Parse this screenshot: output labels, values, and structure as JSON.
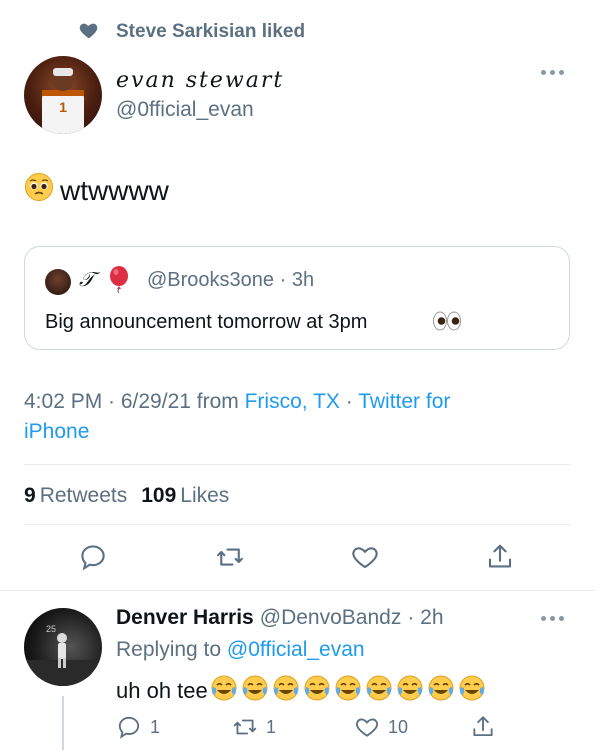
{
  "liked_by": {
    "text": "Steve Sarkisian liked"
  },
  "tweet": {
    "author_name": "evan stewart",
    "author_handle": "@0fficial_evan",
    "text": "wtwwww",
    "emoji": "pleading-face"
  },
  "quoted": {
    "name": "𝒯",
    "handle_time": "@Brooks3one · 3h",
    "text": "Big announcement tomorrow at 3pm"
  },
  "meta": {
    "time_date": "4:02 PM · 6/29/21 from ",
    "location": "Frisco, TX",
    "sep": " · ",
    "source_part1": "Twitter for",
    "source_part2": "iPhone"
  },
  "stats": {
    "retweets_count": "9",
    "retweets_label": "Retweets",
    "likes_count": "109",
    "likes_label": "Likes"
  },
  "reply": {
    "name": "Denver Harris",
    "handle": "@DenvoBandz",
    "time": "· 2h",
    "replying_prefix": "Replying to ",
    "replying_to": "@0fficial_evan",
    "text": "uh oh tee",
    "emoji_count": 9,
    "reply_count": "1",
    "retweet_count": "1",
    "like_count": "10"
  },
  "colors": {
    "accent": "#1d9bf0",
    "muted": "#5b7083",
    "border": "#cfd9de"
  }
}
